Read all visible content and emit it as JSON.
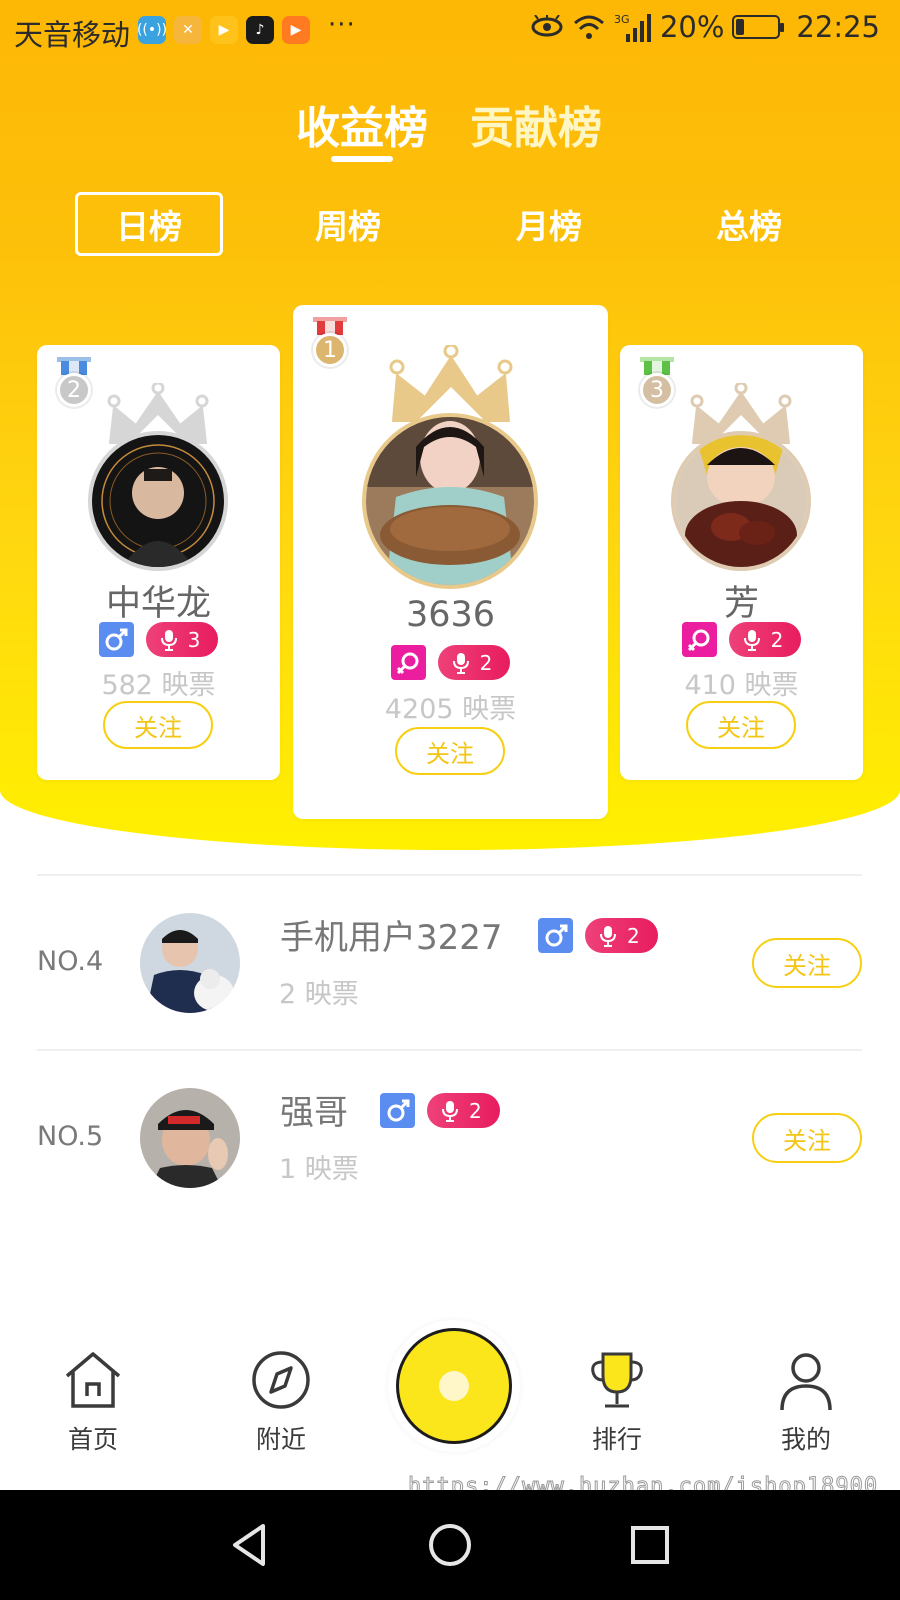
{
  "status_bar": {
    "carrier": "天音移动",
    "network": "3G",
    "battery": "20%",
    "time": "22:25",
    "more": "···"
  },
  "main_tabs": [
    {
      "label": "收益榜",
      "active": true
    },
    {
      "label": "贡献榜",
      "active": false
    }
  ],
  "period_tabs": [
    {
      "label": "日榜",
      "active": true
    },
    {
      "label": "周榜",
      "active": false
    },
    {
      "label": "月榜",
      "active": false
    },
    {
      "label": "总榜",
      "active": false
    }
  ],
  "podium": {
    "first": {
      "rank": "1",
      "name": "3636",
      "gender": "female",
      "level": "2",
      "votes": "4205 映票",
      "follow": "关注"
    },
    "second": {
      "rank": "2",
      "name": "中华龙",
      "gender": "male",
      "level": "3",
      "votes": "582 映票",
      "follow": "关注"
    },
    "third": {
      "rank": "3",
      "name": "芳",
      "gender": "female",
      "level": "2",
      "votes": "410 映票",
      "follow": "关注"
    }
  },
  "list": [
    {
      "rank": "NO.4",
      "name": "手机用户3227",
      "gender": "male",
      "level": "2",
      "votes": "2 映票",
      "follow": "关注"
    },
    {
      "rank": "NO.5",
      "name": "强哥",
      "gender": "male",
      "level": "2",
      "votes": "1 映票",
      "follow": "关注"
    }
  ],
  "bottom_nav": [
    {
      "label": "首页",
      "icon": "home-icon"
    },
    {
      "label": "附近",
      "icon": "compass-icon"
    },
    {
      "label": "",
      "icon": "live-record-icon"
    },
    {
      "label": "排行",
      "icon": "trophy-icon"
    },
    {
      "label": "我的",
      "icon": "profile-icon"
    }
  ],
  "watermark": "https://www.huzhan.com/ishop18900",
  "colors": {
    "gradient_top": "#fdb705",
    "gradient_bottom": "#fff000",
    "accent_yellow": "#f7cf12",
    "level_pink": "#e81c5e",
    "male_blue": "#5b8cf0",
    "female_magenta": "#ec1ea0"
  }
}
